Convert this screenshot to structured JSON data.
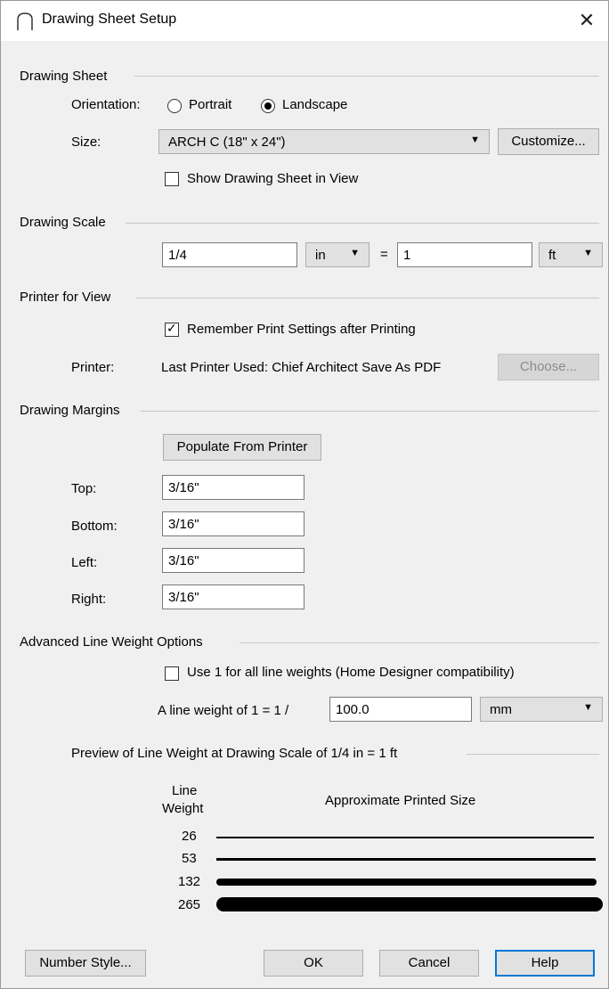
{
  "window": {
    "title": "Drawing Sheet Setup",
    "close_glyph": "✕",
    "title_icon": "arch-icon"
  },
  "drawing_sheet": {
    "group_label": "Drawing Sheet",
    "orientation_label": "Orientation:",
    "portrait_label": "Portrait",
    "landscape_label": "Landscape",
    "orientation_selected": "Landscape",
    "size_label": "Size:",
    "size_value": "ARCH C  (18\" x 24\")",
    "customize_label": "Customize...",
    "show_sheet_label": "Show Drawing Sheet in View",
    "show_sheet_checked": false
  },
  "drawing_scale": {
    "group_label": "Drawing Scale",
    "left_value": "1/4",
    "left_unit": "in",
    "equals": "=",
    "right_value": "1",
    "right_unit": "ft"
  },
  "printer": {
    "group_label": "Printer for View",
    "remember_label": "Remember Print Settings after Printing",
    "remember_checked": true,
    "printer_label": "Printer:",
    "printer_value": "Last Printer Used:  Chief Architect Save As PDF",
    "choose_label": "Choose..."
  },
  "margins": {
    "group_label": "Drawing Margins",
    "populate_label": "Populate From Printer",
    "top_label": "Top:",
    "top_value": "3/16\"",
    "bottom_label": "Bottom:",
    "bottom_value": "3/16\"",
    "left_label": "Left:",
    "left_value": "3/16\"",
    "right_label": "Right:",
    "right_value": "3/16\""
  },
  "line_weight": {
    "group_label": "Advanced Line Weight Options",
    "use1_label": "Use 1 for all line weights (Home Designer compatibility)",
    "use1_checked": false,
    "weight_label": "A line weight of 1 = 1 /",
    "weight_value": "100.0",
    "weight_unit": "mm",
    "preview_label": "Preview of Line Weight at Drawing Scale of  1/4 in = 1 ft",
    "col_weight_1": "Line",
    "col_weight_2": "Weight",
    "col_size": "Approximate Printed Size",
    "rows": [
      "26",
      "53",
      "132",
      "265"
    ]
  },
  "footer": {
    "number_style_label": "Number Style...",
    "ok_label": "OK",
    "cancel_label": "Cancel",
    "help_label": "Help"
  }
}
